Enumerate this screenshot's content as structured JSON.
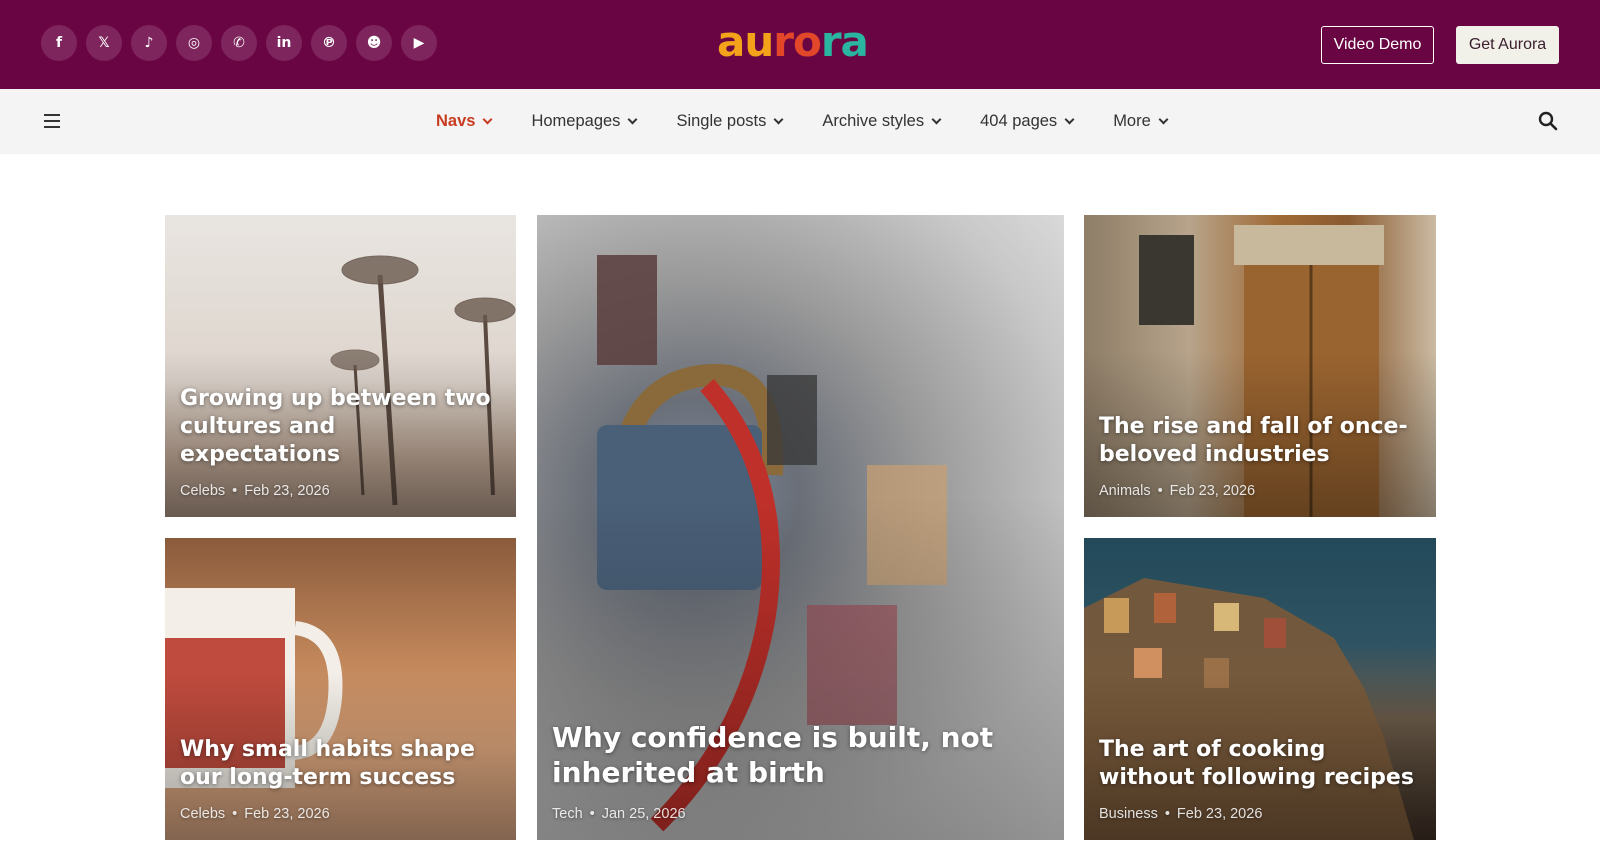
{
  "header": {
    "socials": [
      {
        "icon": "facebook-icon",
        "glyph": "f"
      },
      {
        "icon": "x-twitter-icon",
        "glyph": "𝕏"
      },
      {
        "icon": "tiktok-icon",
        "glyph": "♪"
      },
      {
        "icon": "instagram-icon",
        "glyph": "◎"
      },
      {
        "icon": "whatsapp-icon",
        "glyph": "✆"
      },
      {
        "icon": "linkedin-icon",
        "glyph": "in"
      },
      {
        "icon": "pinterest-icon",
        "glyph": "℗"
      },
      {
        "icon": "reddit-icon",
        "glyph": "☻"
      },
      {
        "icon": "youtube-icon",
        "glyph": "▶"
      }
    ],
    "logo": {
      "part1": "au",
      "part2": "ro",
      "part3": "ra"
    },
    "video_demo": "Video Demo",
    "get_aurora": "Get Aurora"
  },
  "nav": {
    "items": [
      {
        "label": "Navs",
        "active": true
      },
      {
        "label": "Homepages",
        "active": false
      },
      {
        "label": "Single posts",
        "active": false
      },
      {
        "label": "Archive styles",
        "active": false
      },
      {
        "label": "404 pages",
        "active": false
      },
      {
        "label": "More",
        "active": false
      }
    ]
  },
  "posts": [
    {
      "title": "Growing up between two cultures and expectations",
      "category": "Celebs",
      "date": "Feb 23, 2026"
    },
    {
      "title": "Why confidence is built, not inherited at birth",
      "category": "Tech",
      "date": "Jan 25, 2026"
    },
    {
      "title": "The rise and fall of once-beloved industries",
      "category": "Animals",
      "date": "Feb 23, 2026"
    },
    {
      "title": "Why small habits shape our long-term success",
      "category": "Celebs",
      "date": "Feb 23, 2026"
    },
    {
      "title": "The art of cooking without following recipes",
      "category": "Business",
      "date": "Feb 23, 2026"
    }
  ],
  "colors": {
    "topbar_bg": "#6a0544",
    "nav_active": "#c83b20",
    "nav_bg": "#f4f4f4"
  }
}
